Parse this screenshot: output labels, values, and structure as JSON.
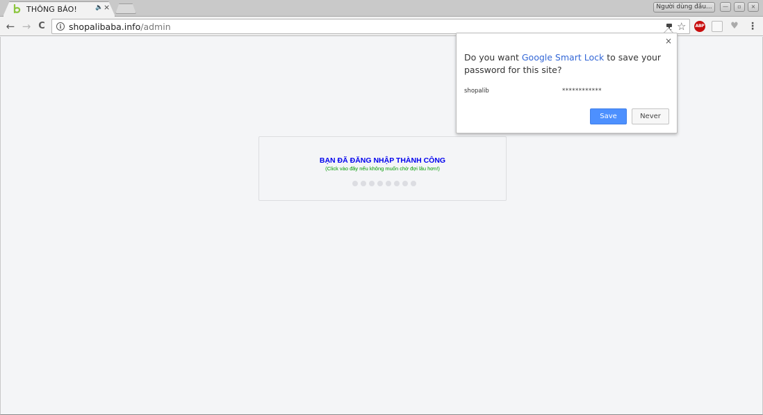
{
  "tabs": [
    {
      "title": "THÔNG BÁO!",
      "favicon": "b-logo-icon",
      "audio_icon": "🔈",
      "close_icon": "×"
    }
  ],
  "window": {
    "profile_label": "Người dùng đầu...",
    "minimize": "—",
    "restore": "▫",
    "close": "×"
  },
  "toolbar": {
    "back": "←",
    "forward": "→",
    "reload": "C",
    "info": "i",
    "url_host": "shopalibaba.info",
    "url_path": "/admin",
    "star": "☆",
    "abp_label": "ABP",
    "menu": "⋮"
  },
  "page": {
    "notice_title": "BẠN ĐÃ ĐĂNG NHẬP THÀNH CÔNG",
    "notice_sub": "(Click vào đây nếu không muốn chờ đợi lâu hơn!)",
    "loader_dot_count": 8
  },
  "smart_lock": {
    "close": "×",
    "text_before": "Do you want ",
    "link_text": "Google Smart Lock",
    "text_after": " to save your password for this site?",
    "username": "shopalib",
    "password_masked": "************",
    "save_label": "Save",
    "never_label": "Never"
  },
  "colors": {
    "accent_blue": "#4d90fe",
    "link_blue": "#3367d6",
    "notice_title": "#0000ee",
    "notice_sub": "#009900",
    "abp_red": "#c70d0d"
  }
}
